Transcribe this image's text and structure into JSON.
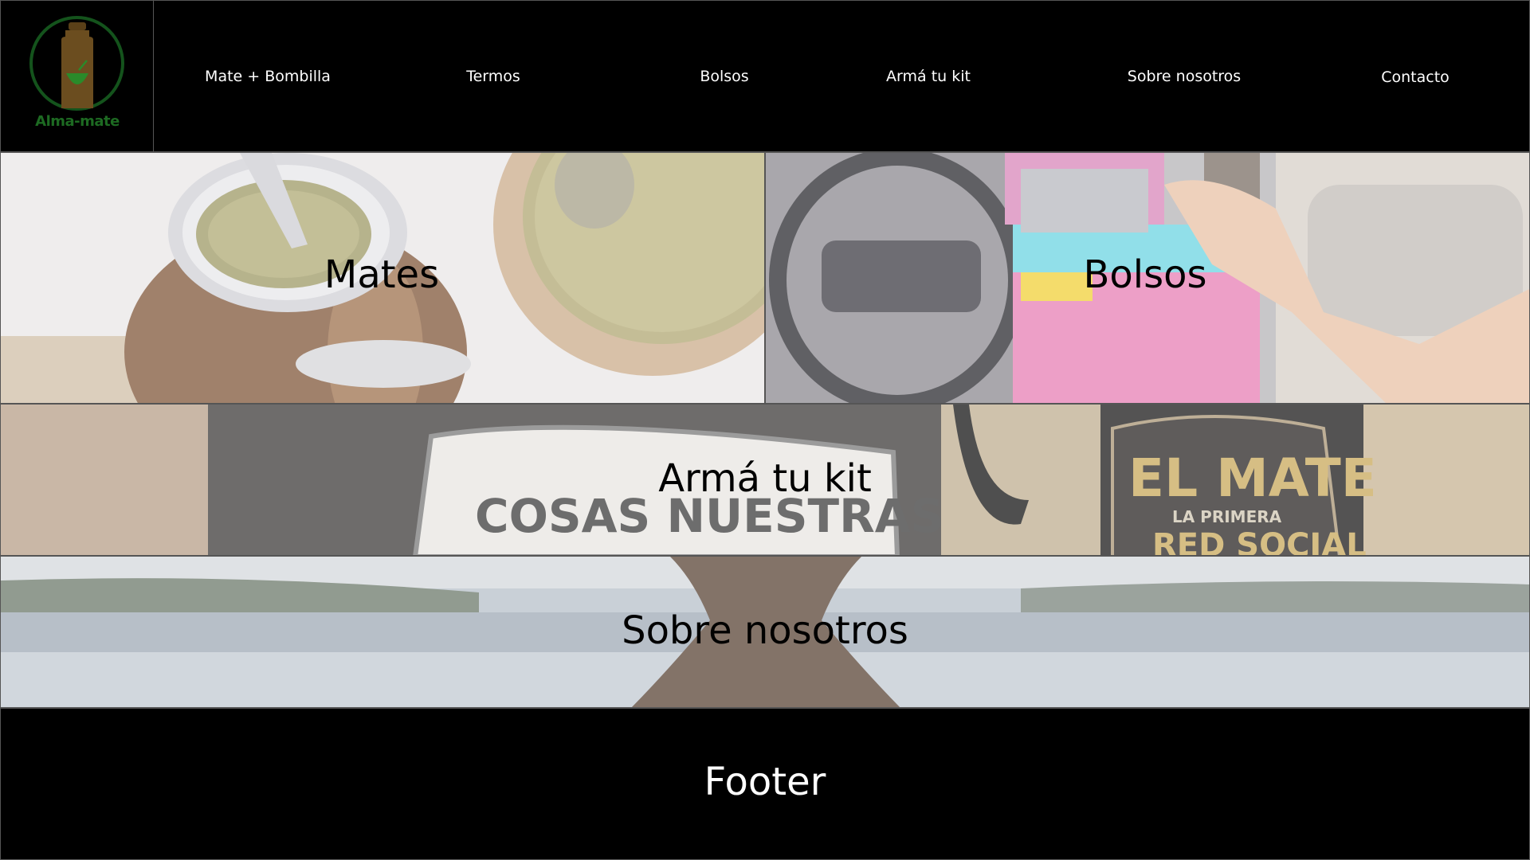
{
  "brand": {
    "name": "Alma-mate"
  },
  "nav": {
    "items": [
      {
        "label": "Mate + Bombilla"
      },
      {
        "label": "Termos"
      },
      {
        "label": "Bolsos"
      },
      {
        "label": "Armá tu kit"
      },
      {
        "label": "Sobre nosotros"
      },
      {
        "label": "Contacto"
      }
    ]
  },
  "panels": {
    "mates": {
      "label": "Mates"
    },
    "bolsos": {
      "label": "Bolsos"
    },
    "kit": {
      "label": "Armá tu kit",
      "image_text_1": "COSAS NUESTRAS",
      "image_text_2": "EL MATE",
      "image_text_3": "LA PRIMERA",
      "image_text_4": "RED SOCIAL"
    },
    "sobre": {
      "label": "Sobre nosotros"
    }
  },
  "footer": {
    "label": "Footer"
  },
  "colors": {
    "header_bg": "#000000",
    "logo_green": "#1d6a22",
    "bottle_brown": "#6b4d1f",
    "nav_text": "#ffffff",
    "panel_text": "#000000",
    "footer_text": "#ffffff"
  }
}
